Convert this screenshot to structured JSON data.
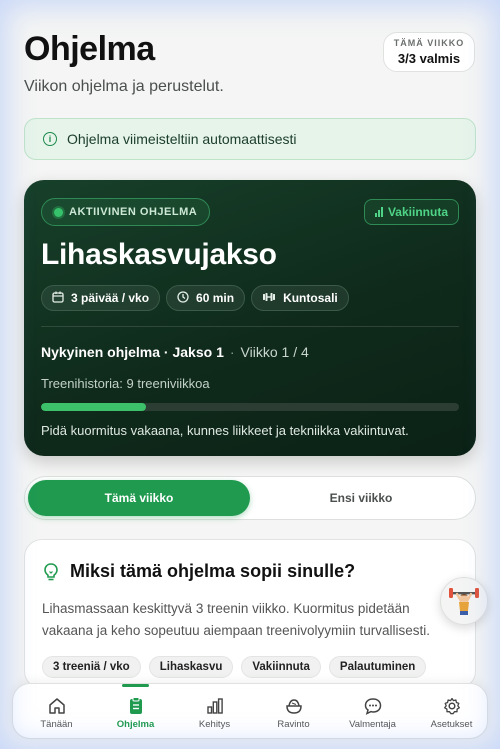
{
  "header": {
    "title": "Ohjelma",
    "subtitle": "Viikon ohjelma ja perustelut.",
    "week_label": "TÄMÄ VIIKKO",
    "week_value": "3/3 valmis"
  },
  "banner": {
    "text": "Ohjelma viimeisteltiin automaattisesti",
    "icon": "info-icon"
  },
  "program_card": {
    "status_badge": "AKTIIVINEN OHJELMA",
    "action_label": "Vakiinnuta",
    "title": "Lihaskasvujakso",
    "chips": [
      {
        "icon": "calendar-icon",
        "label": "3 päivää / vko"
      },
      {
        "icon": "clock-icon",
        "label": "60 min"
      },
      {
        "icon": "dumbbell-icon",
        "label": "Kuntosali"
      }
    ],
    "current_label": "Nykyinen ohjelma · Jakso 1",
    "separator": "·",
    "week_text": "Viikko 1 / 4",
    "history": "Treenihistoria: 9 treeniviikkoa",
    "progress": 0.25,
    "note": "Pidä kuormitus vakaana, kunnes liikkeet ja tekniikka vakiintuvat."
  },
  "tabs": {
    "active": "Tämä viikko",
    "inactive": "Ensi viikko"
  },
  "reason": {
    "icon": "lightbulb-icon",
    "title": "Miksi tämä ohjelma sopii sinulle?",
    "body": "Lihasmassaan keskittyvä 3 treenin viikko. Kuormitus pidetään vakaana ja keho sopeutuu aiempaan treenivolyymiin turvallisesti.",
    "tags": [
      "3 treeniä / vko",
      "Lihaskasvu",
      "Vakiinnuta",
      "Palautuminen"
    ]
  },
  "nav": {
    "items": [
      {
        "label": "Tänään",
        "icon": "home-icon"
      },
      {
        "label": "Ohjelma",
        "icon": "clipboard-icon"
      },
      {
        "label": "Kehitys",
        "icon": "bar-chart-icon"
      },
      {
        "label": "Ravinto",
        "icon": "food-bowl-icon"
      },
      {
        "label": "Valmentaja",
        "icon": "chat-bubble-icon"
      },
      {
        "label": "Asetukset",
        "icon": "gear-icon"
      }
    ],
    "active_index": 1
  },
  "colors": {
    "accent": "#1f9a4f",
    "card_bg": "#0f2a1b",
    "progress_fill": "#3cc06a"
  }
}
